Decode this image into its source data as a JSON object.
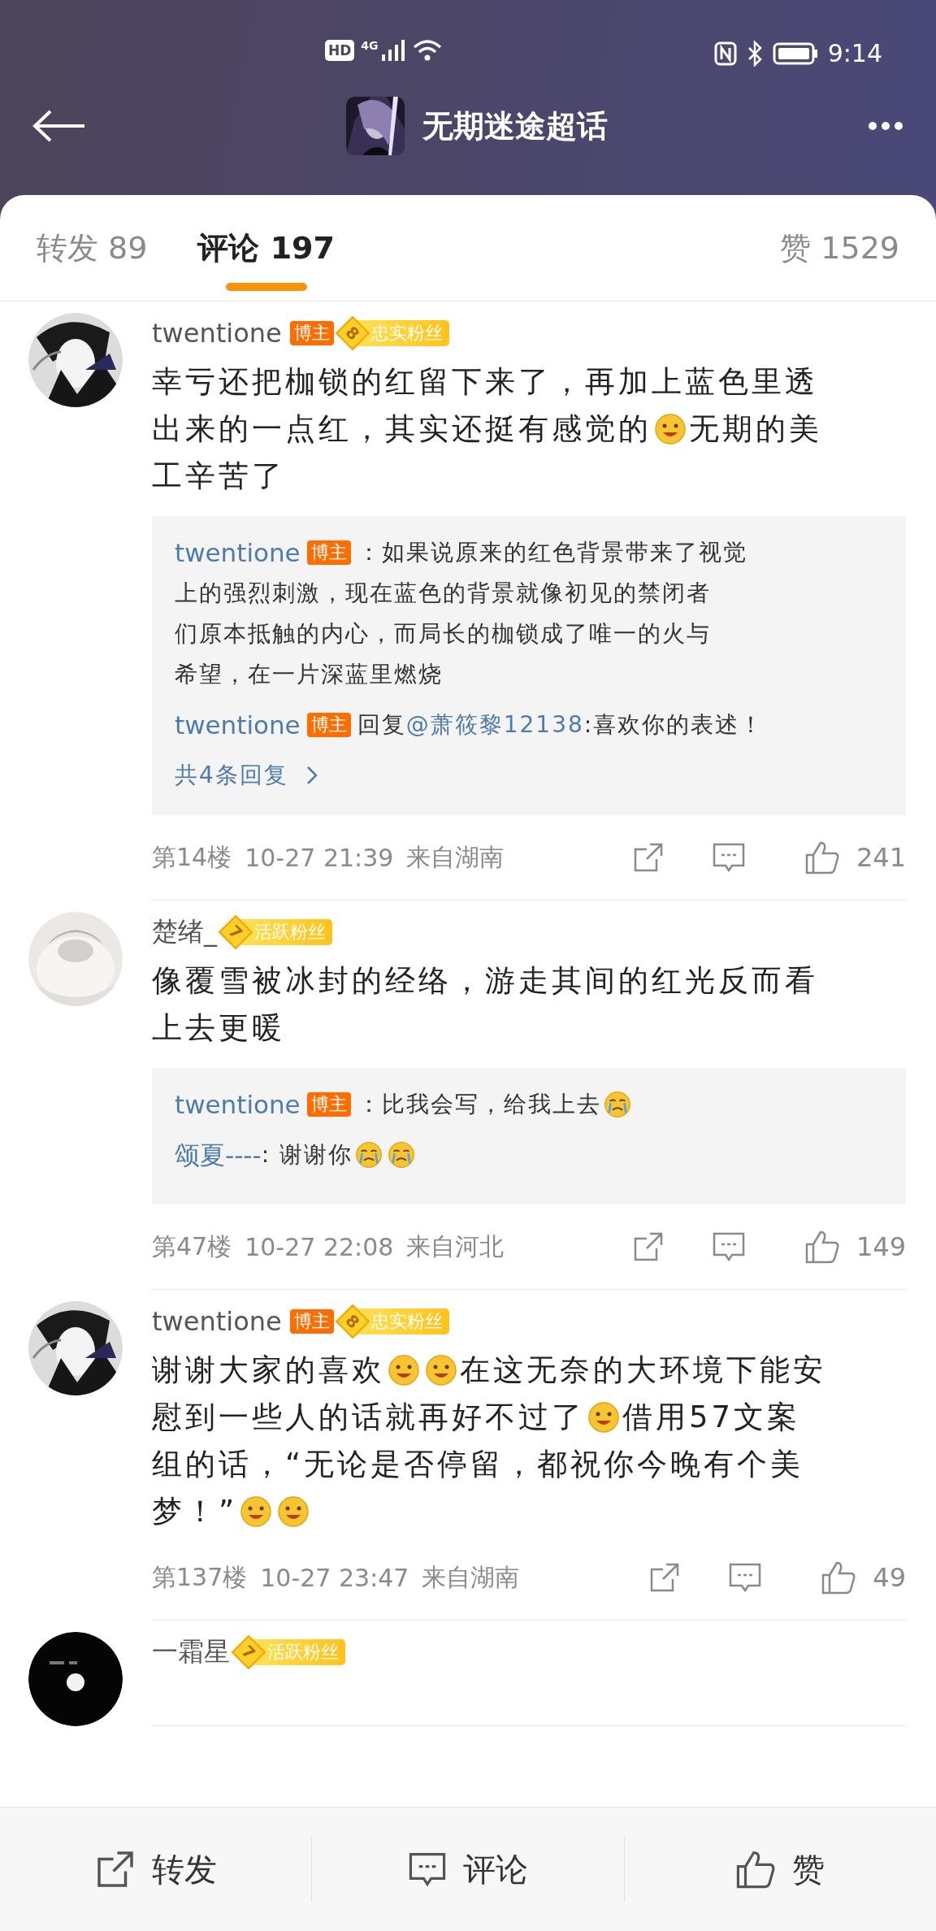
{
  "status_bar": {
    "hd": "HD",
    "network": "4G",
    "time": "9:14"
  },
  "header": {
    "title": "无期迷途超话"
  },
  "tabs": [
    {
      "label": "转发",
      "count": "89",
      "selected": false
    },
    {
      "label": "评论",
      "count": "197",
      "selected": true
    },
    {
      "label": "赞",
      "count": "1529",
      "selected": false
    }
  ],
  "comments": [
    {
      "user": "twentione",
      "tags": [
        {
          "kind": "blogger",
          "text": "博主"
        },
        {
          "kind": "fan",
          "rank": "8",
          "text": "忠实粉丝"
        }
      ],
      "body": [
        [
          {
            "kind": "text",
            "text": "幸亏还把枷锁的红留下来了，再加上蓝色里透"
          }
        ],
        [
          {
            "kind": "text",
            "text": "出来的一点红，其实还挺有感觉的"
          },
          {
            "kind": "emoji"
          },
          {
            "kind": "text",
            "text": "无期的美"
          }
        ],
        [
          {
            "kind": "text",
            "text": "工辛苦了"
          }
        ]
      ],
      "replies": [
        {
          "user": "twentione",
          "tags": [
            {
              "kind": "blogger",
              "text": "博主"
            }
          ],
          "lines": [
            [
              {
                "kind": "text",
                "text": "：如果说原来的红色背景带来了视觉"
              }
            ],
            [
              {
                "kind": "text",
                "text": "上的强烈刺激，现在蓝色的背景就像初见的禁闭者"
              }
            ],
            [
              {
                "kind": "text",
                "text": "们原本抵触的内心，而局长的枷锁成了唯一的火与"
              }
            ],
            [
              {
                "kind": "text",
                "text": "希望，在一片深蓝里燃烧"
              }
            ]
          ]
        },
        {
          "user": "twentione",
          "tags": [
            {
              "kind": "blogger",
              "text": "博主"
            }
          ],
          "lines": [
            [
              {
                "kind": "text",
                "text": "回复"
              },
              {
                "kind": "mention",
                "text": "@萧筱黎12138"
              },
              {
                "kind": "text",
                "text": ":喜欢你的表述！"
              }
            ]
          ]
        }
      ],
      "more_replies": "共4条回复",
      "floor": "第14楼",
      "time": "10-27 21:39",
      "location": "来自湖南",
      "likes": "241"
    },
    {
      "user": "楚绪_",
      "tags": [
        {
          "kind": "fan",
          "rank": "7",
          "text": "活跃粉丝"
        }
      ],
      "body": [
        [
          {
            "kind": "text",
            "text": "像覆雪被冰封的经络，游走其间的红光反而看"
          }
        ],
        [
          {
            "kind": "text",
            "text": "上去更暖"
          }
        ]
      ],
      "replies": [
        {
          "user": "twentione",
          "tags": [
            {
              "kind": "blogger",
              "text": "博主"
            }
          ],
          "lines": [
            [
              {
                "kind": "text",
                "text": "：比我会写，给我上去"
              },
              {
                "kind": "emoji"
              }
            ]
          ]
        },
        {
          "user": "颂夏----",
          "lines": [
            [
              {
                "kind": "text",
                "text": ": 谢谢你"
              },
              {
                "kind": "emoji"
              },
              {
                "kind": "emoji"
              }
            ]
          ]
        }
      ],
      "floor": "第47楼",
      "time": "10-27 22:08",
      "location": "来自河北",
      "likes": "149"
    },
    {
      "user": "twentione",
      "tags": [
        {
          "kind": "blogger",
          "text": "博主"
        },
        {
          "kind": "fan",
          "rank": "8",
          "text": "忠实粉丝"
        }
      ],
      "body": [
        [
          {
            "kind": "text",
            "text": "谢谢大家的喜欢"
          },
          {
            "kind": "emoji"
          },
          {
            "kind": "emoji"
          },
          {
            "kind": "text",
            "text": "在这无奈的大环境下能安"
          }
        ],
        [
          {
            "kind": "text",
            "text": "慰到一些人的话就再好不过了"
          },
          {
            "kind": "emoji"
          },
          {
            "kind": "text",
            "text": "借用57文案"
          }
        ],
        [
          {
            "kind": "text",
            "text": "组的话，“无论是否停留，都祝你今晚有个美"
          }
        ],
        [
          {
            "kind": "text",
            "text": "梦！”"
          },
          {
            "kind": "emoji"
          },
          {
            "kind": "emoji"
          }
        ]
      ],
      "floor": "第137楼",
      "time": "10-27 23:47",
      "location": "来自湖南",
      "likes": "49"
    },
    {
      "user": "一霜星",
      "tags": [
        {
          "kind": "fan",
          "rank": "7",
          "text": "活跃粉丝"
        }
      ]
    }
  ],
  "bottom_bar": [
    {
      "kind": "share",
      "label": "转发"
    },
    {
      "kind": "comment",
      "label": "评论"
    },
    {
      "kind": "like",
      "label": "赞"
    }
  ]
}
